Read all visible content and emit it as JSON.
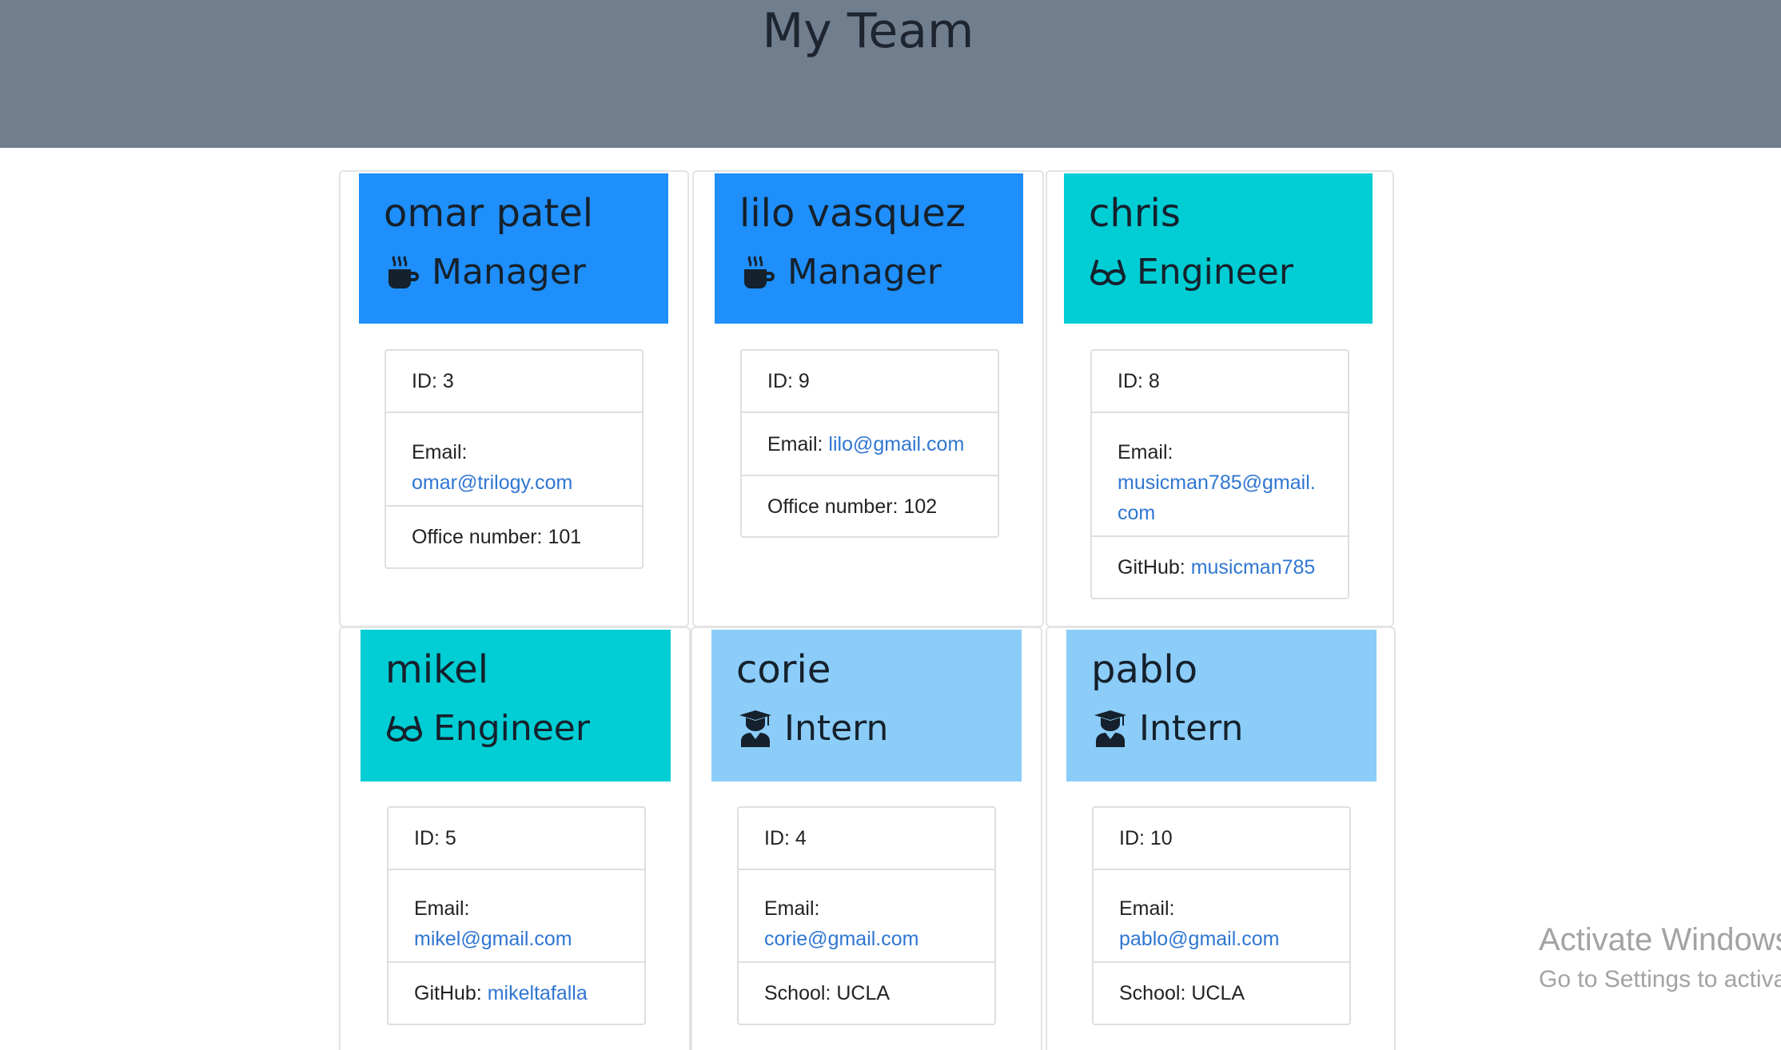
{
  "header": {
    "title": "My Team"
  },
  "team": [
    {
      "name": "omar patel",
      "role": "Manager",
      "icon": "coffee-icon",
      "color": "#1f8ffb",
      "id_text": "ID: 3",
      "email_label": "Email: ",
      "email": "omar@trilogy.com",
      "extra_label": "Office number: 101",
      "extra_link": ""
    },
    {
      "name": "lilo vasquez",
      "role": "Manager",
      "icon": "coffee-icon",
      "color": "#1f8ffb",
      "id_text": "ID: 9",
      "email_label": "Email: ",
      "email": "lilo@gmail.com",
      "extra_label": "Office number: 102",
      "extra_link": ""
    },
    {
      "name": "chris",
      "role": "Engineer",
      "icon": "glasses-icon",
      "color": "#00cdd4",
      "id_text": "ID: 8",
      "email_label": "Email: ",
      "email": "musicman785@gmail.com",
      "extra_label": "GitHub: ",
      "extra_link": "musicman785"
    },
    {
      "name": "mikel",
      "role": "Engineer",
      "icon": "glasses-icon",
      "color": "#00cdd4",
      "id_text": "ID: 5",
      "email_label": "Email: ",
      "email": "mikel@gmail.com",
      "extra_label": "GitHub: ",
      "extra_link": "mikeltafalla"
    },
    {
      "name": "corie",
      "role": "Intern",
      "icon": "graduate-icon",
      "color": "#8bcdf8",
      "id_text": "ID: 4",
      "email_label": "Email: ",
      "email": "corie@gmail.com",
      "extra_label": "School: UCLA",
      "extra_link": ""
    },
    {
      "name": "pablo",
      "role": "Intern",
      "icon": "graduate-icon",
      "color": "#8bcdf8",
      "id_text": "ID: 10",
      "email_label": "Email: ",
      "email": "pablo@gmail.com",
      "extra_label": "School: UCLA",
      "extra_link": ""
    }
  ],
  "watermark": {
    "line1": "Activate Windows",
    "line2": "Go to Settings to activate Windows."
  }
}
